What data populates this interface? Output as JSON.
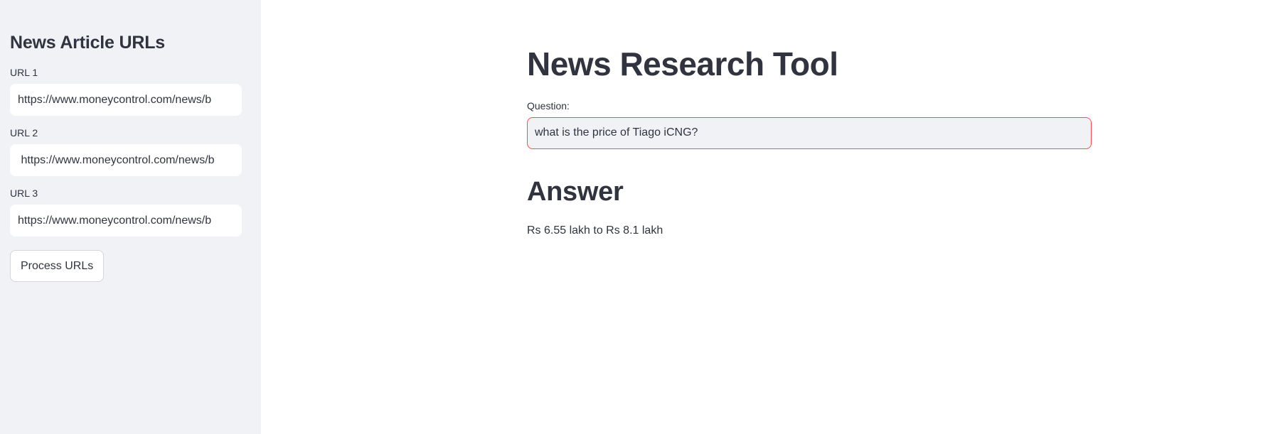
{
  "sidebar": {
    "title": "News Article URLs",
    "urls": [
      {
        "label": "URL 1",
        "value": "https://www.moneycontrol.com/news/b"
      },
      {
        "label": "URL 2",
        "value": " https://www.moneycontrol.com/news/b"
      },
      {
        "label": "URL 3",
        "value": "https://www.moneycontrol.com/news/b"
      }
    ],
    "process_button_label": "Process URLs"
  },
  "main": {
    "title": "News Research Tool",
    "question_label": "Question:",
    "question_value": "what is the price of Tiago iCNG?",
    "answer_heading": "Answer",
    "answer_text": "Rs 6.55 lakh to Rs 8.1 lakh"
  },
  "colors": {
    "sidebar_bg": "#f0f2f6",
    "text": "#31333f",
    "focus_border": "#ff4b4b"
  }
}
